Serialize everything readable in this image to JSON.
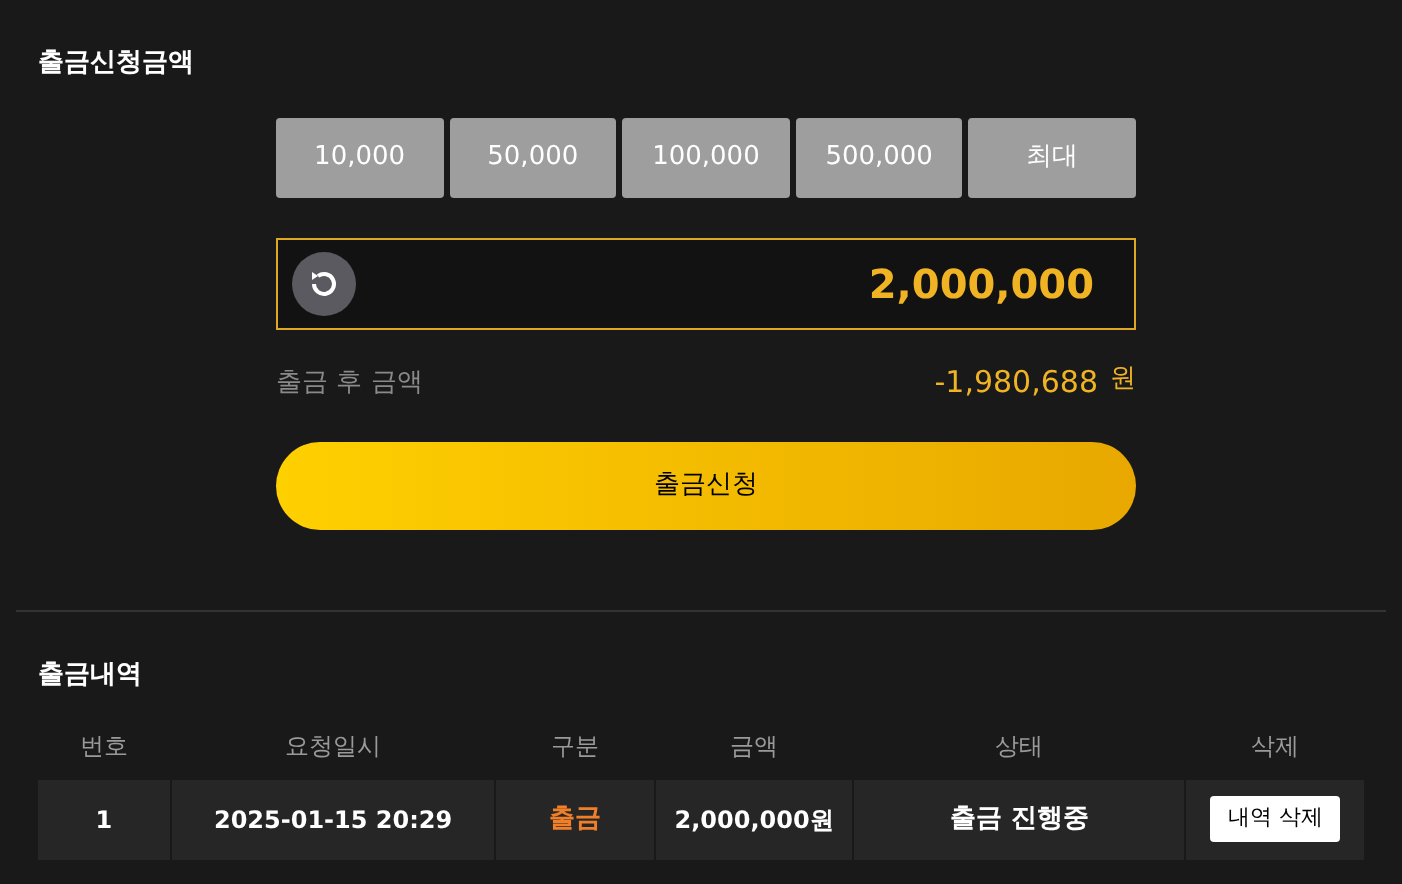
{
  "request": {
    "title": "출금신청금액",
    "quick_amounts": [
      "10,000",
      "50,000",
      "100,000",
      "500,000",
      "최대"
    ],
    "amount": "2,000,000",
    "after_label": "출금 후 금액",
    "after_value": "-1,980,688",
    "after_unit": "원",
    "submit": "출금신청"
  },
  "history": {
    "title": "출금내역",
    "columns": [
      "번호",
      "요청일시",
      "구분",
      "금액",
      "상태",
      "삭제"
    ],
    "rows": [
      {
        "no": "1",
        "date": "2025-01-15 20:29",
        "type": "출금",
        "amount": "2,000,000원",
        "status": "출금 진행중",
        "action": "내역 삭제"
      }
    ]
  }
}
